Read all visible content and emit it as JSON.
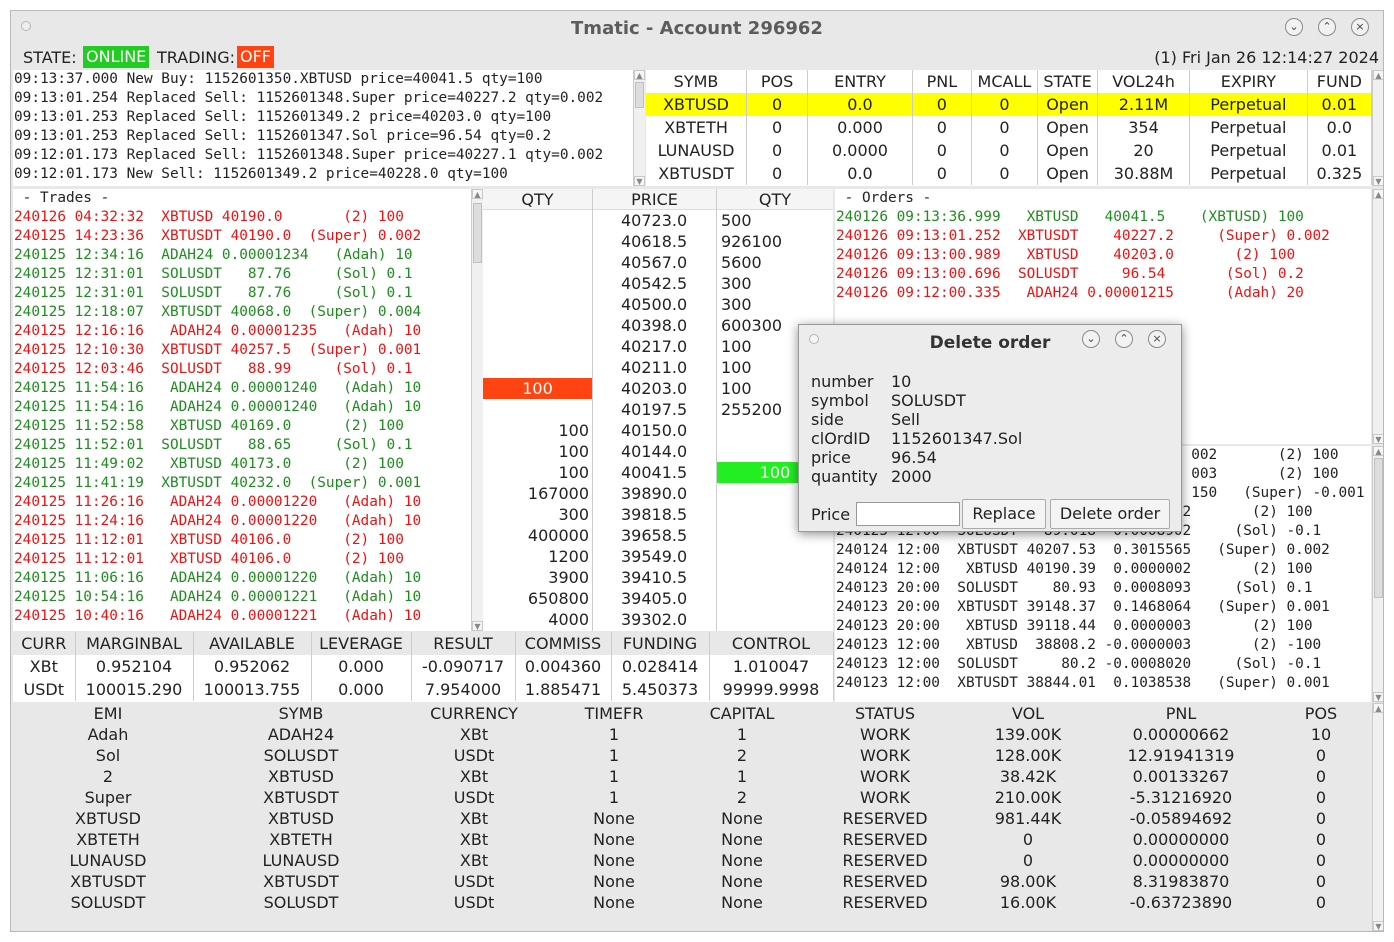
{
  "window": {
    "title": "Tmatic - Account 296962"
  },
  "status": {
    "state_label": "STATE:",
    "state_value": "ONLINE",
    "trading_label": "TRADING:",
    "trading_value": "OFF",
    "clock": "(1)  Fri Jan 26 12:14:27 2024"
  },
  "colors": {
    "online": "#22cc22",
    "off": "#ff4411",
    "highlight": "#ffff00",
    "buy": "#1e8c1e",
    "sell": "#ee1111",
    "bid_bar": "#ff4411",
    "ask_bar": "#22ee22"
  },
  "log": [
    "09:13:37.000 New Buy: 1152601350.XBTUSD price=40041.5 qty=100",
    "09:13:01.254 Replaced Sell: 1152601348.Super price=40227.2 qty=0.002",
    "09:13:01.253 Replaced Sell: 1152601349.2 price=40203.0 qty=100",
    "09:13:01.253 Replaced Sell: 1152601347.Sol price=96.54 qty=0.2",
    "09:12:01.173 Replaced Sell: 1152601348.Super price=40227.1 qty=0.002",
    "09:12:01.173 New Sell: 1152601349.2 price=40228.0 qty=100"
  ],
  "symbols": {
    "headers": [
      "SYMB",
      "POS",
      "ENTRY",
      "PNL",
      "MCALL",
      "STATE",
      "VOL24h",
      "EXPIRY",
      "FUND"
    ],
    "rows": [
      [
        "XBTUSD",
        "0",
        "0.0",
        "0",
        "0",
        "Open",
        "2.11M",
        "Perpetual",
        "0.01"
      ],
      [
        "XBTETH",
        "0",
        "0.000",
        "0",
        "0",
        "Open",
        "354",
        "Perpetual",
        "0.0"
      ],
      [
        "LUNAUSD",
        "0",
        "0.0000",
        "0",
        "0",
        "Open",
        "20",
        "Perpetual",
        "0.01"
      ],
      [
        "XBTUSDT",
        "0",
        "0.0",
        "0",
        "0",
        "Open",
        "30.88M",
        "Perpetual",
        "0.325"
      ]
    ]
  },
  "trades": {
    "title": " - Trades -",
    "rows": [
      {
        "t": "240126 04:32:32  XBTUSD 40190.0       (2) 100",
        "s": "r"
      },
      {
        "t": "240125 14:23:36  XBTUSDT 40190.0  (Super) 0.002",
        "s": "r"
      },
      {
        "t": "240125 12:34:16  ADAH24 0.00001234   (Adah) 10",
        "s": "g"
      },
      {
        "t": "240125 12:31:01  SOLUSDT   87.76     (Sol) 0.1",
        "s": "g"
      },
      {
        "t": "240125 12:31:01  SOLUSDT   87.76     (Sol) 0.1",
        "s": "g"
      },
      {
        "t": "240125 12:18:07  XBTUSDT 40068.0  (Super) 0.004",
        "s": "g"
      },
      {
        "t": "240125 12:16:16   ADAH24 0.00001235   (Adah) 10",
        "s": "r"
      },
      {
        "t": "240125 12:10:30  XBTUSDT 40257.5  (Super) 0.001",
        "s": "r"
      },
      {
        "t": "240125 12:03:46  SOLUSDT   88.99     (Sol) 0.1",
        "s": "r"
      },
      {
        "t": "240125 11:54:16   ADAH24 0.00001240   (Adah) 10",
        "s": "g"
      },
      {
        "t": "240125 11:54:16   ADAH24 0.00001240   (Adah) 10",
        "s": "g"
      },
      {
        "t": "240125 11:52:58   XBTUSD 40169.0      (2) 100",
        "s": "g"
      },
      {
        "t": "240125 11:52:01  SOLUSDT   88.65     (Sol) 0.1",
        "s": "g"
      },
      {
        "t": "240125 11:49:02   XBTUSD 40173.0      (2) 100",
        "s": "g"
      },
      {
        "t": "240125 11:41:19  XBTUSDT 40232.0  (Super) 0.001",
        "s": "g"
      },
      {
        "t": "240125 11:26:16   ADAH24 0.00001220   (Adah) 10",
        "s": "r"
      },
      {
        "t": "240125 11:24:16   ADAH24 0.00001220   (Adah) 10",
        "s": "r"
      },
      {
        "t": "240125 11:12:01   XBTUSD 40106.0      (2) 100",
        "s": "r"
      },
      {
        "t": "240125 11:12:01   XBTUSD 40106.0      (2) 100",
        "s": "r"
      },
      {
        "t": "240125 11:06:16   ADAH24 0.00001220   (Adah) 10",
        "s": "g"
      },
      {
        "t": "240125 10:54:16   ADAH24 0.00001221   (Adah) 10",
        "s": "g"
      },
      {
        "t": "240125 10:40:16   ADAH24 0.00001221   (Adah) 10",
        "s": "r"
      }
    ]
  },
  "book": {
    "headers": [
      "QTY",
      "PRICE",
      "QTY"
    ],
    "asks": [
      {
        "price": "40723.0",
        "qty": "500"
      },
      {
        "price": "40618.5",
        "qty": "926100"
      },
      {
        "price": "40567.0",
        "qty": "5600"
      },
      {
        "price": "40542.5",
        "qty": "300"
      },
      {
        "price": "40500.0",
        "qty": "300"
      },
      {
        "price": "40398.0",
        "qty": "600300"
      },
      {
        "price": "40217.0",
        "qty": "100"
      },
      {
        "price": "40211.0",
        "qty": "100"
      },
      {
        "price": "40203.0",
        "qty": "100",
        "mine": "100"
      },
      {
        "price": "40197.5",
        "qty": "255200"
      }
    ],
    "bids": [
      {
        "price": "40150.0",
        "qty": "100"
      },
      {
        "price": "40144.0",
        "qty": "100"
      },
      {
        "price": "40041.5",
        "qty": "100",
        "mine": "100"
      },
      {
        "price": "39890.0",
        "qty": "167000"
      },
      {
        "price": "39818.5",
        "qty": "300"
      },
      {
        "price": "39658.5",
        "qty": "400000"
      },
      {
        "price": "39549.0",
        "qty": "1200"
      },
      {
        "price": "39410.5",
        "qty": "3900"
      },
      {
        "price": "39405.0",
        "qty": "650800"
      },
      {
        "price": "39302.0",
        "qty": "4000"
      }
    ]
  },
  "orders": {
    "title": " - Orders -",
    "rows": [
      {
        "t": "240126 09:13:36.999   XBTUSD   40041.5    (XBTUSD) 100",
        "s": "g"
      },
      {
        "t": "240126 09:13:01.252  XBTUSDT    40227.2     (Super) 0.002",
        "s": "r"
      },
      {
        "t": "240126 09:13:00.989   XBTUSD    40203.0       (2) 100",
        "s": "r"
      },
      {
        "t": "240126 09:13:00.696  SOLUSDT     96.54       (Sol) 0.2",
        "s": "r"
      },
      {
        "t": "240126 09:12:00.335   ADAH24 0.00001215      (Adah) 20",
        "s": "r"
      }
    ]
  },
  "funding": {
    "rows": [
      "                                         002       (2) 100",
      "                                         003       (2) 100",
      "                                         150   (Super) -0.001",
      "240125 12:00   XBTUSD 40158.14  0.0000002       (2) 100",
      "240125 12:00  SOLUSDT   89.018 -0.0008902     (Sol) -0.1",
      "240124 12:00  XBTUSDT 40207.53  0.3015565   (Super) 0.002",
      "240124 12:00   XBTUSD 40190.39  0.0000002       (2) 100",
      "240123 20:00  SOLUSDT    80.93  0.0008093     (Sol) 0.1",
      "240123 20:00  XBTUSDT 39148.37  0.1468064   (Super) 0.001",
      "240123 20:00   XBTUSD 39118.44  0.0000003       (2) 100",
      "240123 12:00   XBTUSD  38808.2 -0.0000003       (2) -100",
      "240123 12:00  SOLUSDT     80.2 -0.0008020     (Sol) -0.1",
      "240123 12:00  XBTUSDT 38844.01  0.1038538   (Super) 0.001"
    ]
  },
  "account": {
    "headers": [
      "CURR",
      "MARGINBAL",
      "AVAILABLE",
      "LEVERAGE",
      "RESULT",
      "COMMISS",
      "FUNDING",
      "CONTROL"
    ],
    "rows": [
      [
        "XBt",
        "0.952104",
        "0.952062",
        "0.000",
        "-0.090717",
        "0.004360",
        "0.028414",
        "1.010047"
      ],
      [
        "USDt",
        "100015.290",
        "100013.755",
        "0.000",
        "7.954000",
        "1.885471",
        "5.450373",
        "99999.9998"
      ]
    ]
  },
  "bots": {
    "headers": [
      "EMI",
      "SYMB",
      "CURRENCY",
      "TIMEFR",
      "CAPITAL",
      "STATUS",
      "VOL",
      "PNL",
      "POS"
    ],
    "rows": [
      [
        "Adah",
        "ADAH24",
        "XBt",
        "1",
        "1",
        "WORK",
        "139.00K",
        "0.00000662",
        "10"
      ],
      [
        "Sol",
        "SOLUSDT",
        "USDt",
        "1",
        "2",
        "WORK",
        "128.00K",
        "12.91941319",
        "0"
      ],
      [
        "2",
        "XBTUSD",
        "XBt",
        "1",
        "1",
        "WORK",
        "38.42K",
        "0.00133267",
        "0"
      ],
      [
        "Super",
        "XBTUSDT",
        "USDt",
        "1",
        "2",
        "WORK",
        "210.00K",
        "-5.31216920",
        "0"
      ],
      [
        "XBTUSD",
        "XBTUSD",
        "XBt",
        "None",
        "None",
        "RESERVED",
        "981.44K",
        "-0.05894692",
        "0"
      ],
      [
        "XBTETH",
        "XBTETH",
        "XBt",
        "None",
        "None",
        "RESERVED",
        "0",
        "0.00000000",
        "0"
      ],
      [
        "LUNAUSD",
        "LUNAUSD",
        "XBt",
        "None",
        "None",
        "RESERVED",
        "0",
        "0.00000000",
        "0"
      ],
      [
        "XBTUSDT",
        "XBTUSDT",
        "USDt",
        "None",
        "None",
        "RESERVED",
        "98.00K",
        "8.31983870",
        "0"
      ],
      [
        "SOLUSDT",
        "SOLUSDT",
        "USDt",
        "None",
        "None",
        "RESERVED",
        "16.00K",
        "-0.63723890",
        "0"
      ]
    ]
  },
  "dialog": {
    "title": "Delete order",
    "fields": [
      {
        "k": "number",
        "v": "10"
      },
      {
        "k": "symbol",
        "v": "SOLUSDT"
      },
      {
        "k": "side",
        "v": "Sell"
      },
      {
        "k": "clOrdID",
        "v": "1152601347.Sol"
      },
      {
        "k": "price",
        "v": "96.54"
      },
      {
        "k": "quantity",
        "v": "2000"
      }
    ],
    "price_label": "Price",
    "price_value": "",
    "replace_label": "Replace",
    "delete_label": "Delete order"
  },
  "icons": {
    "minimize": "chevron-down-icon",
    "maximize": "chevron-up-icon",
    "close": "close-icon"
  }
}
